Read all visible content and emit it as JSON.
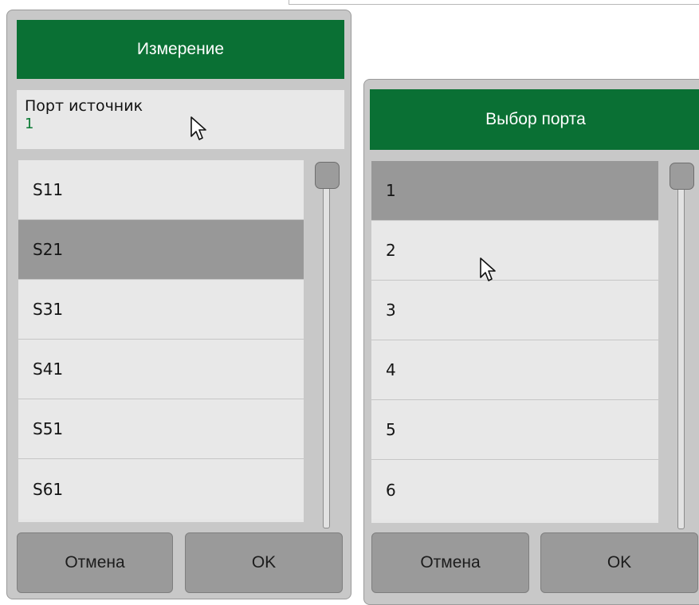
{
  "measurement_dialog": {
    "title": "Измерение",
    "source_port_label": "Порт источник",
    "source_port_value": "1",
    "items": [
      "S11",
      "S21",
      "S31",
      "S41",
      "S51",
      "S61"
    ],
    "selected_item": "S21",
    "cancel_label": "Отмена",
    "ok_label": "OK"
  },
  "port_select_dialog": {
    "title": "Выбор порта",
    "items": [
      "1",
      "2",
      "3",
      "4",
      "5",
      "6"
    ],
    "selected_item": "1",
    "cancel_label": "Отмена",
    "ok_label": "OK"
  },
  "colors": {
    "header_green": "#0a7034",
    "value_green": "#0a7a34",
    "selected_row": "#989898",
    "panel_bg": "#c8c8c8"
  },
  "icons": [
    "scroll-thumb",
    "mouse-pointer-icon"
  ]
}
